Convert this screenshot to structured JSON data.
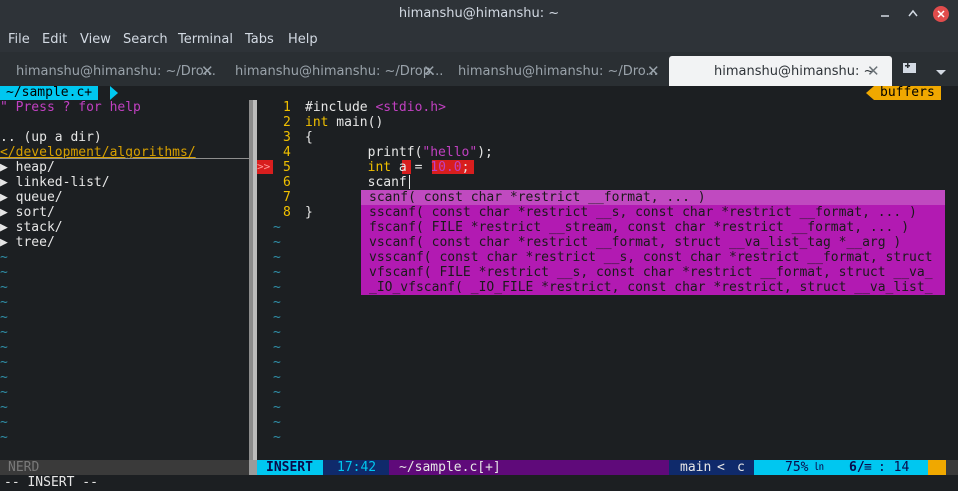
{
  "window": {
    "title": "himanshu@himanshu: ~"
  },
  "menu": [
    "File",
    "Edit",
    "View",
    "Search",
    "Terminal",
    "Tabs",
    "Help"
  ],
  "tabs": [
    {
      "label": "himanshu@himanshu: ~/Dro...",
      "active": false
    },
    {
      "label": "himanshu@himanshu: ~/Drop...",
      "active": false
    },
    {
      "label": "himanshu@himanshu: ~/Dro...",
      "active": false
    },
    {
      "label": "himanshu@himanshu: ~",
      "active": true
    }
  ],
  "vim": {
    "tabline": {
      "file_tab": "~/sample.c+",
      "buffers_label": "buffers"
    },
    "nerdtree": {
      "help": "\" Press ? for help",
      "up": ".. (up a dir)",
      "root": "</development/algorithms/",
      "dirs": [
        "heap/",
        "linked-list/",
        "queue/",
        "sort/",
        "stack/",
        "tree/"
      ],
      "status": "NERD"
    },
    "sign": ">>",
    "code": [
      {
        "num": "1",
        "text": "#include <stdio.h>"
      },
      {
        "num": "2",
        "text": "int main()"
      },
      {
        "num": "3",
        "text": "{"
      },
      {
        "num": "4",
        "text": "        printf(\"hello\");"
      },
      {
        "num": "5",
        "text": "        int a = 10.0;"
      },
      {
        "num": "6",
        "text": "        scanf"
      },
      {
        "num": "7",
        "text": ""
      },
      {
        "num": "8",
        "text": "}"
      }
    ],
    "completions": [
      "scanf( const char *restrict __format, ... )",
      "sscanf( const char *restrict __s, const char *restrict __format, ... )",
      "fscanf( FILE *restrict __stream, const char *restrict __format, ... )",
      "vscanf( const char *restrict __format, struct __va_list_tag *__arg )",
      "vsscanf( const char *restrict __s, const char *restrict __format, struct",
      "vfscanf( FILE *restrict __s, const char *restrict __format, struct __va_",
      "_IO_vfscanf( _IO_FILE *restrict, const char *restrict, struct __va_list_"
    ],
    "statusline": {
      "mode": "INSERT",
      "time": "17:42",
      "file": "~/sample.c[+]",
      "branch": "main",
      "filetype": "c",
      "percent": "75%",
      "ln": "㏑",
      "position": "6/8",
      "col_sep": "≡",
      "col": ": 14"
    },
    "cmdline": "-- INSERT --"
  },
  "colors": {
    "cyan": "#00c7f0",
    "orange": "#f0a800",
    "magenta": "#b21ab2",
    "red": "#d81e1e",
    "purple": "#5f0a7a",
    "navy": "#0f2a6b"
  }
}
